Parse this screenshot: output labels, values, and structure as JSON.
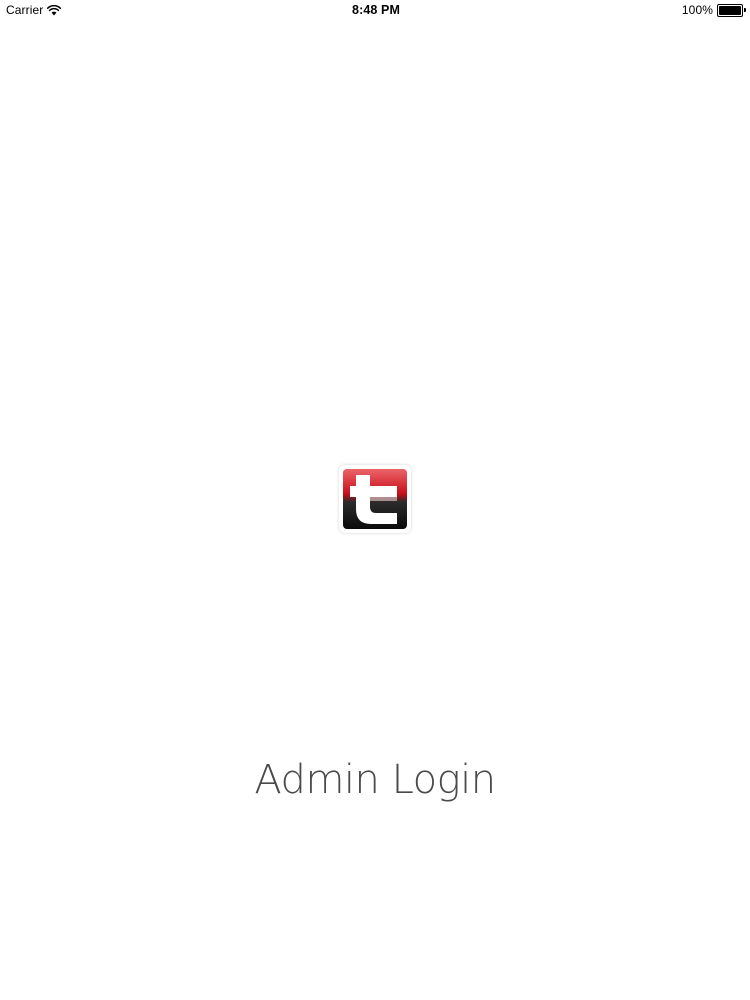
{
  "status_bar": {
    "carrier": "Carrier",
    "time": "8:48 PM",
    "battery": "100%",
    "battery_level": 1.0
  },
  "logo": {
    "icon": "t-letter-logo-icon",
    "colors": {
      "top": "#e1101b",
      "bottom": "#0b0b0b",
      "letter": "#ffffff"
    }
  },
  "main": {
    "title": "Admin Login",
    "title_color": "#4a4a4a"
  }
}
